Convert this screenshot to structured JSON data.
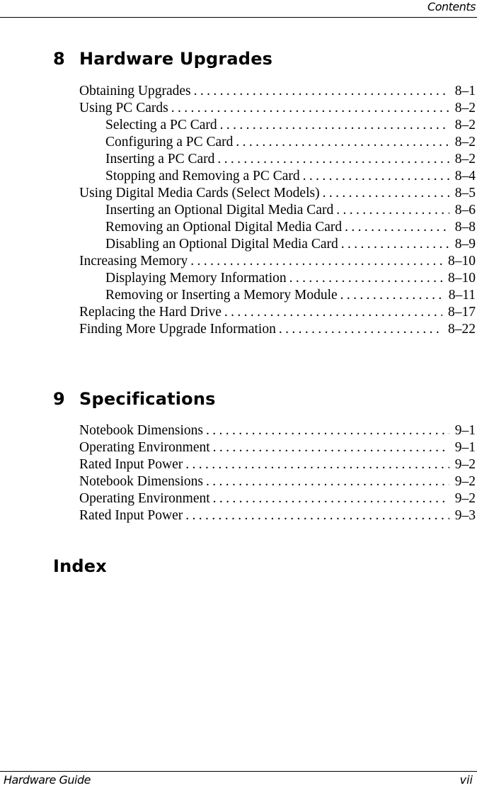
{
  "header": {
    "running_title": "Contents"
  },
  "footer": {
    "book_title": "Hardware Guide",
    "page_number": "vii"
  },
  "chapters": [
    {
      "number": "8",
      "title": "Hardware Upgrades",
      "entries": [
        {
          "level": 1,
          "title": "Obtaining Upgrades",
          "page": "8–1"
        },
        {
          "level": 1,
          "title": "Using PC Cards",
          "page": "8–2"
        },
        {
          "level": 2,
          "title": "Selecting a PC Card",
          "page": "8–2"
        },
        {
          "level": 2,
          "title": "Configuring a PC Card",
          "page": "8–2"
        },
        {
          "level": 2,
          "title": "Inserting a PC Card",
          "page": "8–2"
        },
        {
          "level": 2,
          "title": "Stopping and Removing a PC Card",
          "page": "8–4"
        },
        {
          "level": 1,
          "title": "Using Digital Media Cards (Select Models)",
          "page": "8–5"
        },
        {
          "level": 2,
          "title": "Inserting an Optional Digital Media Card",
          "page": "8–6"
        },
        {
          "level": 2,
          "title": "Removing an Optional Digital Media Card",
          "page": "8–8"
        },
        {
          "level": 2,
          "title": "Disabling an Optional Digital Media Card",
          "page": "8–9"
        },
        {
          "level": 1,
          "title": "Increasing Memory",
          "page": "8–10"
        },
        {
          "level": 2,
          "title": "Displaying Memory Information",
          "page": "8–10"
        },
        {
          "level": 2,
          "title": "Removing or Inserting a Memory Module",
          "page": "8–11"
        },
        {
          "level": 1,
          "title": "Replacing the Hard Drive",
          "page": "8–17"
        },
        {
          "level": 1,
          "title": "Finding More Upgrade Information",
          "page": "8–22"
        }
      ]
    },
    {
      "number": "9",
      "title": "Specifications",
      "entries": [
        {
          "level": 1,
          "title": "Notebook Dimensions",
          "page": "9–1"
        },
        {
          "level": 1,
          "title": "Operating Environment",
          "page": "9–1"
        },
        {
          "level": 1,
          "title": "Rated Input Power",
          "page": "9–2"
        },
        {
          "level": 1,
          "title": "Notebook Dimensions",
          "page": "9–2"
        },
        {
          "level": 1,
          "title": "Operating Environment",
          "page": "9–2"
        },
        {
          "level": 1,
          "title": "Rated Input Power",
          "page": "9–3"
        }
      ]
    },
    {
      "number": "",
      "title": "Index",
      "entries": []
    }
  ]
}
